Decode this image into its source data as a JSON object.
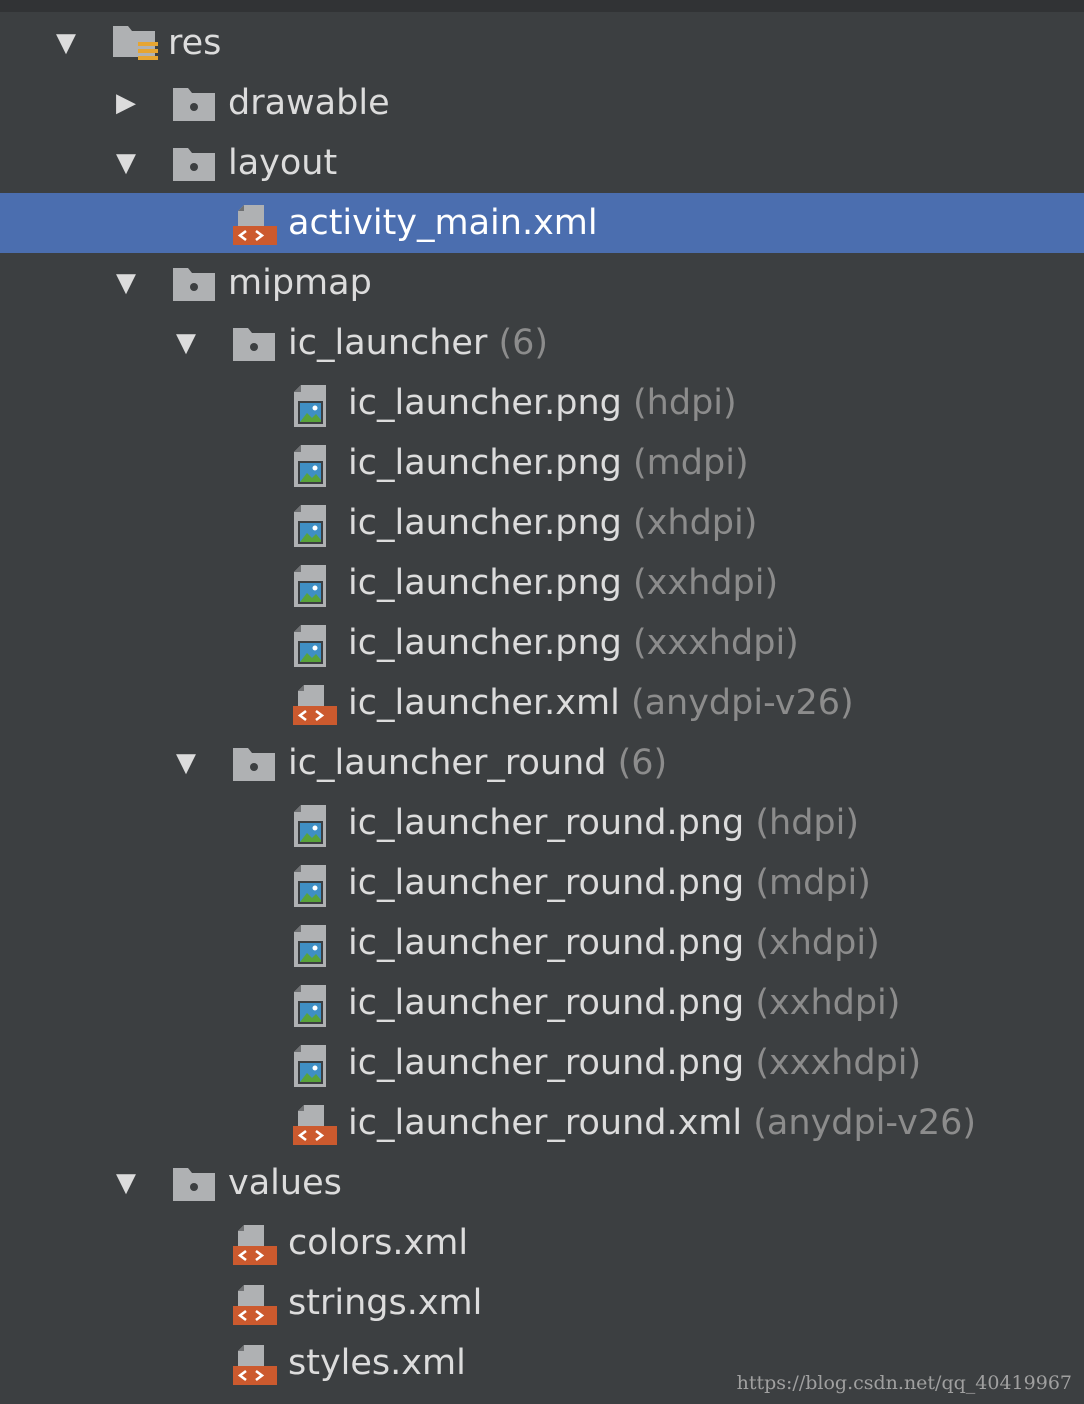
{
  "tree": {
    "items": [
      {
        "label": "res",
        "qualifier": "",
        "depth": 0,
        "icon": "res-folder-icon",
        "expanded": true,
        "has_arrow": true
      },
      {
        "label": "drawable",
        "qualifier": "",
        "depth": 1,
        "icon": "folder-icon",
        "expanded": false,
        "has_arrow": true
      },
      {
        "label": "layout",
        "qualifier": "",
        "depth": 1,
        "icon": "folder-icon",
        "expanded": true,
        "has_arrow": true
      },
      {
        "label": "activity_main.xml",
        "qualifier": "",
        "depth": 2,
        "icon": "xml-file-icon",
        "has_arrow": false,
        "selected": true
      },
      {
        "label": "mipmap",
        "qualifier": "",
        "depth": 1,
        "icon": "folder-icon",
        "expanded": true,
        "has_arrow": true
      },
      {
        "label": "ic_launcher",
        "qualifier": "(6)",
        "depth": 2,
        "icon": "folder-icon",
        "expanded": true,
        "has_arrow": true
      },
      {
        "label": "ic_launcher.png",
        "qualifier": "(hdpi)",
        "depth": 3,
        "icon": "image-file-icon",
        "has_arrow": false
      },
      {
        "label": "ic_launcher.png",
        "qualifier": "(mdpi)",
        "depth": 3,
        "icon": "image-file-icon",
        "has_arrow": false
      },
      {
        "label": "ic_launcher.png",
        "qualifier": "(xhdpi)",
        "depth": 3,
        "icon": "image-file-icon",
        "has_arrow": false
      },
      {
        "label": "ic_launcher.png",
        "qualifier": "(xxhdpi)",
        "depth": 3,
        "icon": "image-file-icon",
        "has_arrow": false
      },
      {
        "label": "ic_launcher.png",
        "qualifier": "(xxxhdpi)",
        "depth": 3,
        "icon": "image-file-icon",
        "has_arrow": false
      },
      {
        "label": "ic_launcher.xml",
        "qualifier": "(anydpi-v26)",
        "depth": 3,
        "icon": "xml-file-icon",
        "has_arrow": false
      },
      {
        "label": "ic_launcher_round",
        "qualifier": "(6)",
        "depth": 2,
        "icon": "folder-icon",
        "expanded": true,
        "has_arrow": true
      },
      {
        "label": "ic_launcher_round.png",
        "qualifier": "(hdpi)",
        "depth": 3,
        "icon": "image-file-icon",
        "has_arrow": false
      },
      {
        "label": "ic_launcher_round.png",
        "qualifier": "(mdpi)",
        "depth": 3,
        "icon": "image-file-icon",
        "has_arrow": false
      },
      {
        "label": "ic_launcher_round.png",
        "qualifier": "(xhdpi)",
        "depth": 3,
        "icon": "image-file-icon",
        "has_arrow": false
      },
      {
        "label": "ic_launcher_round.png",
        "qualifier": "(xxhdpi)",
        "depth": 3,
        "icon": "image-file-icon",
        "has_arrow": false
      },
      {
        "label": "ic_launcher_round.png",
        "qualifier": "(xxxhdpi)",
        "depth": 3,
        "icon": "image-file-icon",
        "has_arrow": false
      },
      {
        "label": "ic_launcher_round.xml",
        "qualifier": "(anydpi-v26)",
        "depth": 3,
        "icon": "xml-file-icon",
        "has_arrow": false
      },
      {
        "label": "values",
        "qualifier": "",
        "depth": 1,
        "icon": "folder-icon",
        "expanded": true,
        "has_arrow": true
      },
      {
        "label": "colors.xml",
        "qualifier": "",
        "depth": 2,
        "icon": "xml-file-icon",
        "has_arrow": false
      },
      {
        "label": "strings.xml",
        "qualifier": "",
        "depth": 2,
        "icon": "xml-file-icon",
        "has_arrow": false
      },
      {
        "label": "styles.xml",
        "qualifier": "",
        "depth": 2,
        "icon": "xml-file-icon",
        "has_arrow": false
      }
    ]
  },
  "watermark": "https://blog.csdn.net/qq_40419967",
  "colors": {
    "background": "#3c3f41",
    "selection": "#4b6eaf",
    "text": "#dcdcdc",
    "qualifier": "#8c8c8c",
    "xml_badge": "#cc5a2e"
  }
}
